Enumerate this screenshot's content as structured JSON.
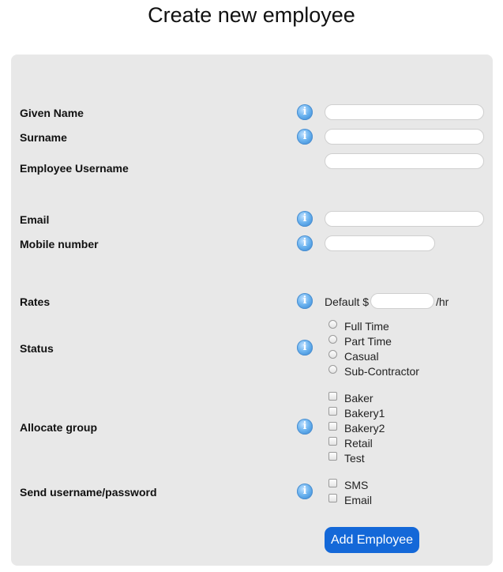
{
  "page": {
    "title": "Create new employee"
  },
  "form": {
    "given_name": {
      "label": "Given Name",
      "value": ""
    },
    "surname": {
      "label": "Surname",
      "value": ""
    },
    "username": {
      "label": "Employee Username",
      "value": ""
    },
    "email": {
      "label": "Email",
      "value": ""
    },
    "mobile": {
      "label": "Mobile number",
      "value": ""
    },
    "rates": {
      "label": "Rates",
      "prefix": "Default $",
      "value": "",
      "suffix": "/hr"
    },
    "status": {
      "label": "Status",
      "options": [
        "Full Time",
        "Part Time",
        "Casual",
        "Sub-Contractor"
      ],
      "selected": null
    },
    "group": {
      "label": "Allocate group",
      "options": [
        "Baker",
        "Bakery1",
        "Bakery2",
        "Retail",
        "Test"
      ],
      "checked": []
    },
    "send": {
      "label": "Send username/password",
      "options": [
        "SMS",
        "Email"
      ],
      "checked": []
    },
    "info_icon_glyph": "i",
    "submit_label": "Add Employee"
  },
  "colors": {
    "panel": "#e8e8e8",
    "button": "#1468d8",
    "info": "#3d8fdc"
  },
  "icons": {
    "info": "info-icon"
  }
}
